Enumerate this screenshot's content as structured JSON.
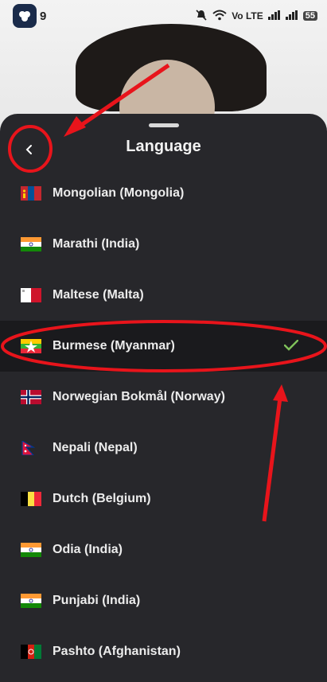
{
  "status_bar": {
    "time": "9",
    "icons": [
      "mute-icon",
      "wifi-icon",
      "volte-icon",
      "signal-icon",
      "signal-icon"
    ],
    "network_label": "Vo LTE",
    "battery": "55"
  },
  "sheet": {
    "title": "Language",
    "back_icon": "chevron-left-icon"
  },
  "languages": [
    {
      "label": "Mongolian (Mongolia)",
      "flag": "mongolia",
      "selected": false
    },
    {
      "label": "Marathi (India)",
      "flag": "india",
      "selected": false
    },
    {
      "label": "Maltese (Malta)",
      "flag": "malta",
      "selected": false
    },
    {
      "label": "Burmese (Myanmar)",
      "flag": "myanmar",
      "selected": true
    },
    {
      "label": "Norwegian Bokmål (Norway)",
      "flag": "norway",
      "selected": false
    },
    {
      "label": "Nepali (Nepal)",
      "flag": "nepal",
      "selected": false
    },
    {
      "label": "Dutch (Belgium)",
      "flag": "belgium",
      "selected": false
    },
    {
      "label": "Odia (India)",
      "flag": "india",
      "selected": false
    },
    {
      "label": "Punjabi (India)",
      "flag": "india",
      "selected": false
    },
    {
      "label": "Pashto (Afghanistan)",
      "flag": "afghanistan",
      "selected": false
    }
  ],
  "colors": {
    "sheet_bg": "#27272b",
    "selected_bg": "#1a1a1d",
    "check": "#7fc15a",
    "annotation": "#e8141b"
  }
}
